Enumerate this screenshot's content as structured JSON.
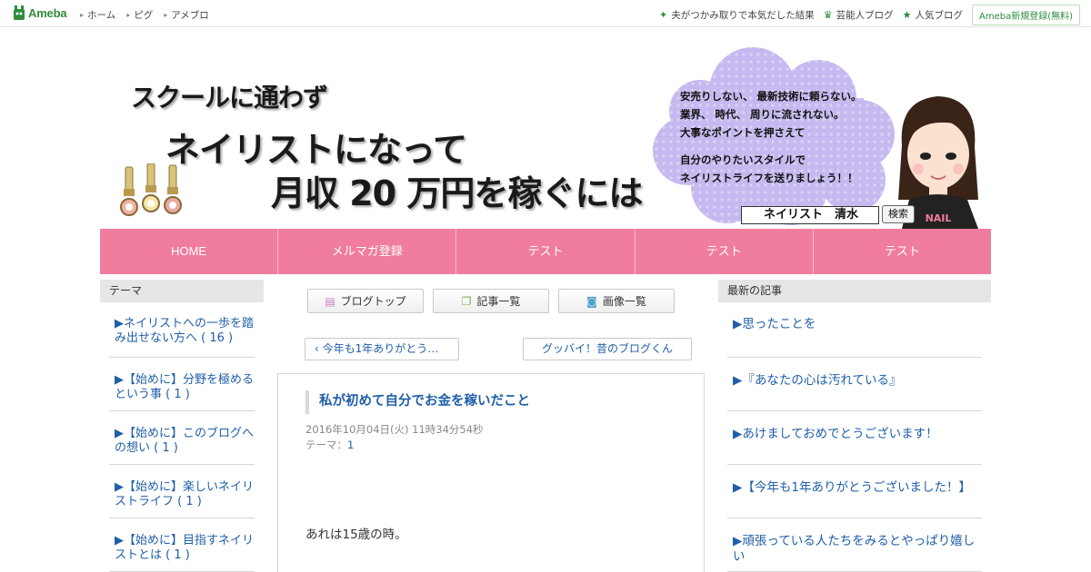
{
  "topbar": {
    "logo_text": "Ameba",
    "nav": [
      "ホーム",
      "ピグ",
      "アメブロ"
    ],
    "right_links": [
      {
        "icon": "sparkle-icon",
        "label": "夫がつかみ取りで本気だした結果"
      },
      {
        "icon": "crown-icon",
        "label": "芸能人ブログ"
      },
      {
        "icon": "star-icon",
        "label": "人気ブログ"
      }
    ],
    "register_label": "Ameba新規登録(無料)",
    "accent_color": "#2d8c3c"
  },
  "header": {
    "line1": "スクールに通わず",
    "line2": "ネイリストになって",
    "line3": "月収 20 万円を稼ぐには",
    "cloud_lines": [
      "安売りしない、 最新技術に頼らない。",
      "業界、 時代、 周りに流されない。",
      "大事なポイントを押さえて",
      "",
      "自分のやりたいスタイルで",
      "ネイリストライフを送りましょう！！"
    ],
    "name_box": "ネイリスト　清水",
    "search_label": "検索",
    "nail_tag": "NAIL"
  },
  "mainnav": {
    "color": "#f07d9e",
    "tabs": [
      "HOME",
      "メルマガ登録",
      "テスト",
      "テスト",
      "テスト"
    ]
  },
  "left_sidebar": {
    "heading": "テーマ",
    "items": [
      "▶ネイリストへの一歩を踏み出せない方へ ( 16 )",
      "▶【始めに】分野を極めるという事 ( 1 )",
      "▶【始めに】このブログへの想い ( 1 )",
      "▶【始めに】楽しいネイリストライフ ( 1 )",
      "▶【始めに】目指すネイリストとは ( 1 )"
    ]
  },
  "center": {
    "tabs": [
      {
        "icon": "document-icon",
        "label": "ブログトップ"
      },
      {
        "icon": "copy-icon",
        "label": "記事一覧"
      },
      {
        "icon": "camera-icon",
        "label": "画像一覧"
      }
    ],
    "prev_label": "今年も1年ありがとう…",
    "next_label": "グッバイ！昔のブログくん",
    "article": {
      "title": "私が初めて自分でお金を稼いだこと",
      "date": "2016年10月04日(火) 11時34分54秒",
      "theme_label": "テーマ：",
      "theme_value": "1",
      "body": "あれは15歳の時。"
    }
  },
  "right_sidebar": {
    "heading": "最新の記事",
    "items": [
      "▶思ったことを",
      "▶『あなたの心は汚れている』",
      "▶あけましておめでとうございます！",
      "▶【今年も1年ありがとうございました！】",
      "▶頑張っている人たちをみるとやっぱり嬉しい"
    ]
  }
}
